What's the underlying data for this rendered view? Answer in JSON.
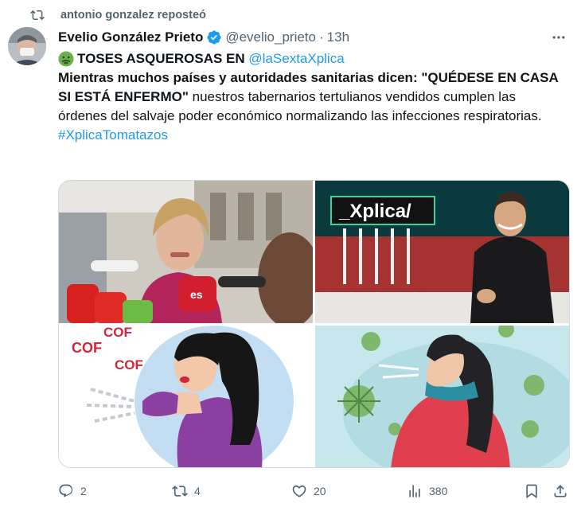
{
  "repost": {
    "text": "antonio gonzalez reposteó",
    "icon": "repost-icon"
  },
  "author": {
    "name": "Evelio González Prieto",
    "handle": "@evelio_prieto",
    "separator": "·",
    "time": "13h",
    "verified_color": "#1d9bf0"
  },
  "tweet": {
    "line1_bold": "TOSES ASQUEROSAS EN",
    "mention": "@laSexta​Xplica",
    "bold_text": "Mientras muchos países y autoridades sanitarias dicen: \"QUÉDESE EN CASA SI ESTÁ ENFERMO\"",
    "plain_text": " nuestros tabernarios tertulianos vendidos cumplen las órdenes del salvaje poder económico normalizando las infecciones respiratorias.",
    "hashtag": "#XplicaTomatazos"
  },
  "media": {
    "img2_logo": "_Xplica/",
    "img3_cof_a": "COF",
    "img3_cof_b": "COF",
    "img3_cof_c": "COF",
    "img1_mic_label": "es"
  },
  "actions": {
    "replies": "2",
    "reposts": "4",
    "likes": "20",
    "views": "380"
  },
  "colors": {
    "accent": "#1d9bf0",
    "muted": "#536471",
    "text": "#0f1419"
  }
}
